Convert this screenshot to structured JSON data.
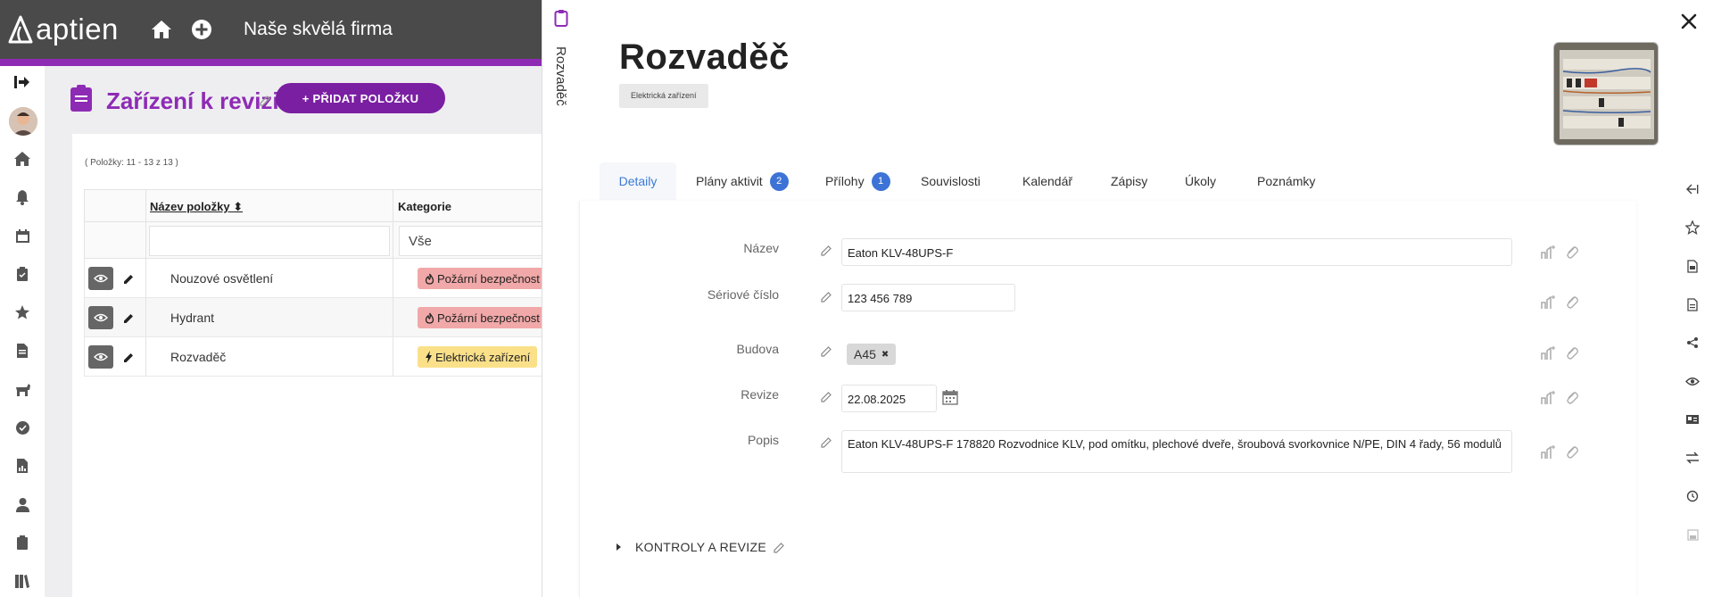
{
  "header": {
    "logo_text": "aptien",
    "company": "Naše skvělá firma"
  },
  "leftnav": {
    "items": [
      "logout-icon",
      "avatar",
      "home-icon",
      "bell-icon",
      "calendar-icon",
      "clipboard-check-icon",
      "star-icon",
      "document-icon",
      "animal-icon",
      "check-circle-icon",
      "report-icon",
      "person-icon",
      "clipboard-icon",
      "books-icon"
    ]
  },
  "main": {
    "title": "Zařízení k revizi",
    "add_button": "+ PŘIDAT POLOŽKU",
    "count_text": "( Položky: 11 - 13 z 13 )",
    "columns": [
      "Název položky",
      "Kategorie"
    ],
    "filter_category": "Vše",
    "rows": [
      {
        "name": "Nouzové osvětlení",
        "category": "Požární bezpečnost",
        "category_type": "fire"
      },
      {
        "name": "Hydrant",
        "category": "Požární bezpečnost",
        "category_type": "fire"
      },
      {
        "name": "Rozvaděč",
        "category": "Elektrická zařízení",
        "category_type": "electric"
      }
    ]
  },
  "drawer": {
    "vertical_tab_label": "Rozvaděč",
    "title": "Rozvaděč",
    "type_badge": "Elektrická zařízení",
    "tabs": [
      {
        "label": "Detaily",
        "badge": null
      },
      {
        "label": "Plány aktivit",
        "badge": "2"
      },
      {
        "label": "Přílohy",
        "badge": "1"
      },
      {
        "label": "Souvislosti",
        "badge": null
      },
      {
        "label": "Kalendář",
        "badge": null
      },
      {
        "label": "Zápisy",
        "badge": null
      },
      {
        "label": "Úkoly",
        "badge": null
      },
      {
        "label": "Poznámky",
        "badge": null
      }
    ],
    "fields": {
      "nazev": {
        "label": "Název",
        "value": "Eaton KLV-48UPS-F"
      },
      "seriove": {
        "label": "Sériové číslo",
        "value": "123 456 789"
      },
      "budova": {
        "label": "Budova",
        "value": "A45"
      },
      "revize": {
        "label": "Revize",
        "value": "22.08.2025"
      },
      "popis": {
        "label": "Popis",
        "value": "Eaton KLV-48UPS-F 178820 Rozvodnice KLV, pod omítku, plechové dveře, šroubová svorkovnice N/PE, DIN 4 řady, 56 modulů"
      }
    },
    "section_kontroly": "KONTROLY A REVIZE"
  },
  "right_strip": {
    "items": [
      "collapse-left-icon",
      "star-outline-icon",
      "pdf-icon",
      "document-icon",
      "share-icon",
      "eye-icon",
      "id-card-icon",
      "transfer-icon",
      "history-icon",
      "save-icon"
    ]
  },
  "colors": {
    "accent_purple": "#8e2bb5",
    "button_purple": "#7a1fa2",
    "header_gray": "#4a4a4a",
    "tab_active_blue": "#3a7bd5",
    "badge_blue": "#3d73d6",
    "fire_badge": "#f1a8a8",
    "electric_badge": "#fbe08a"
  }
}
